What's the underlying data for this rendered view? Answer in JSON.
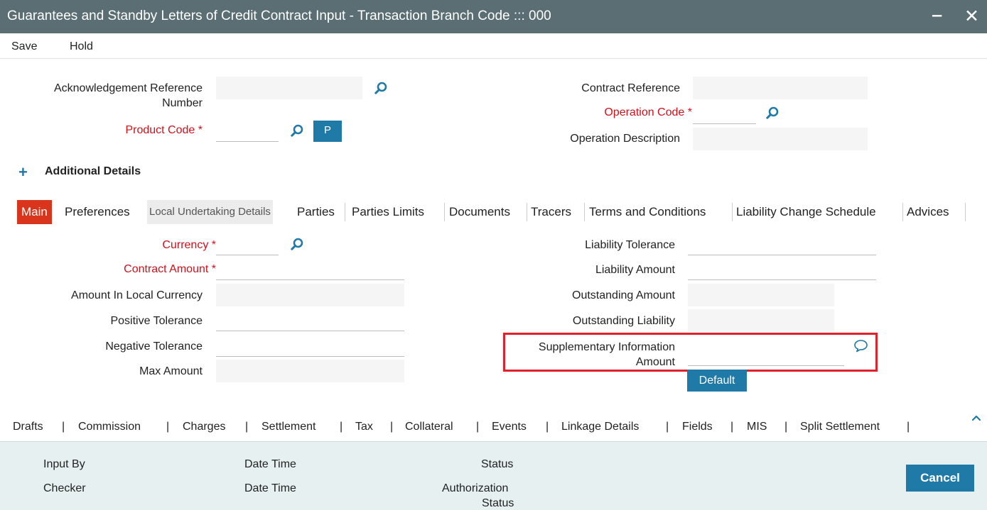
{
  "window": {
    "title": "Guarantees and Standby Letters of Credit Contract Input - Transaction Branch Code ::: 000",
    "minimize": "‒",
    "close": "✕"
  },
  "menu": {
    "save": "Save",
    "hold": "Hold"
  },
  "header": {
    "ack_ref_label_1": "Acknowledgement Reference",
    "ack_ref_label_2": "Number",
    "ack_ref_value": "",
    "product_code_label": "Product Code",
    "product_code_value": "",
    "p_button": "P",
    "contract_ref_label": "Contract Reference",
    "contract_ref_value": "",
    "operation_code_label": "Operation Code",
    "operation_code_value": "",
    "operation_desc_label": "Operation Description",
    "operation_desc_value": "",
    "required_mark": "*"
  },
  "additional_details": {
    "plus": "+",
    "label": "Additional Details"
  },
  "tabs": [
    {
      "label": "Main"
    },
    {
      "label": "Preferences"
    },
    {
      "label": "Local Undertaking Details"
    },
    {
      "label": "Parties"
    },
    {
      "label": "Parties Limits"
    },
    {
      "label": "Documents"
    },
    {
      "label": "Tracers"
    },
    {
      "label": "Terms and Conditions"
    },
    {
      "label": "Liability Change Schedule"
    },
    {
      "label": "Advices"
    }
  ],
  "main_left": {
    "currency_label": "Currency",
    "contract_amount_label": "Contract Amount",
    "amount_local_label": "Amount In Local Currency",
    "positive_tol_label": "Positive Tolerance",
    "negative_tol_label": "Negative Tolerance",
    "max_amount_label": "Max Amount"
  },
  "main_right": {
    "liability_tol_label": "Liability Tolerance",
    "liability_amount_label": "Liability Amount",
    "outstanding_amount_label": "Outstanding Amount",
    "outstanding_liability_label": "Outstanding Liability",
    "supp_info_label_1": "Supplementary Information",
    "supp_info_label_2": "Amount",
    "default_button": "Default"
  },
  "subsystems": [
    "Drafts",
    "Commission",
    "Charges",
    "Settlement",
    "Tax",
    "Collateral",
    "Events",
    "Linkage Details",
    "Fields",
    "MIS",
    "Split Settlement"
  ],
  "subsystem_sep": "|",
  "footer": {
    "input_by": "Input By",
    "checker": "Checker",
    "date_time_1": "Date Time",
    "date_time_2": "Date Time",
    "status": "Status",
    "auth_status_1": "Authorization",
    "auth_status_2": "Status",
    "cancel": "Cancel"
  },
  "icons": {
    "search": "search-icon",
    "comment": "comment-icon",
    "caret": "chevron-up-icon"
  },
  "colors": {
    "titlebar": "#5a6e73",
    "accent": "#1f7aa8",
    "required": "#d0101b",
    "active_tab": "#d9351c",
    "highlight": "#e0202b"
  }
}
